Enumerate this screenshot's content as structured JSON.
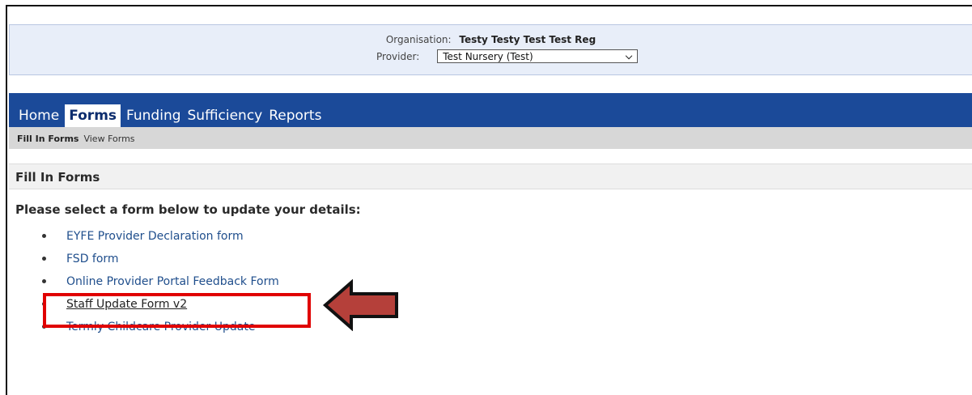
{
  "header": {
    "organisation_label": "Organisation:",
    "organisation_value": "Testy Testy Test Test Reg",
    "provider_label": "Provider:",
    "provider_selected": "Test Nursery (Test)"
  },
  "nav": {
    "tabs": [
      {
        "label": "Home",
        "active": false
      },
      {
        "label": "Forms",
        "active": true
      },
      {
        "label": "Funding",
        "active": false
      },
      {
        "label": "Sufficiency",
        "active": false
      },
      {
        "label": "Reports",
        "active": false
      }
    ]
  },
  "subnav": {
    "current": "Fill In Forms",
    "link": "View Forms"
  },
  "main": {
    "section_title": "Fill In Forms",
    "prompt": "Please select a form below to update your details:",
    "forms": [
      "EYFE Provider Declaration form",
      "FSD form",
      "Online Provider Portal Feedback Form",
      "Staff Update Form v2",
      "Termly Childcare Provider Update"
    ]
  },
  "colors": {
    "nav_background": "#1b4a99",
    "highlight_box": "#e00000",
    "annotation_arrow": "#b5403a",
    "link": "#1f4e8c"
  }
}
